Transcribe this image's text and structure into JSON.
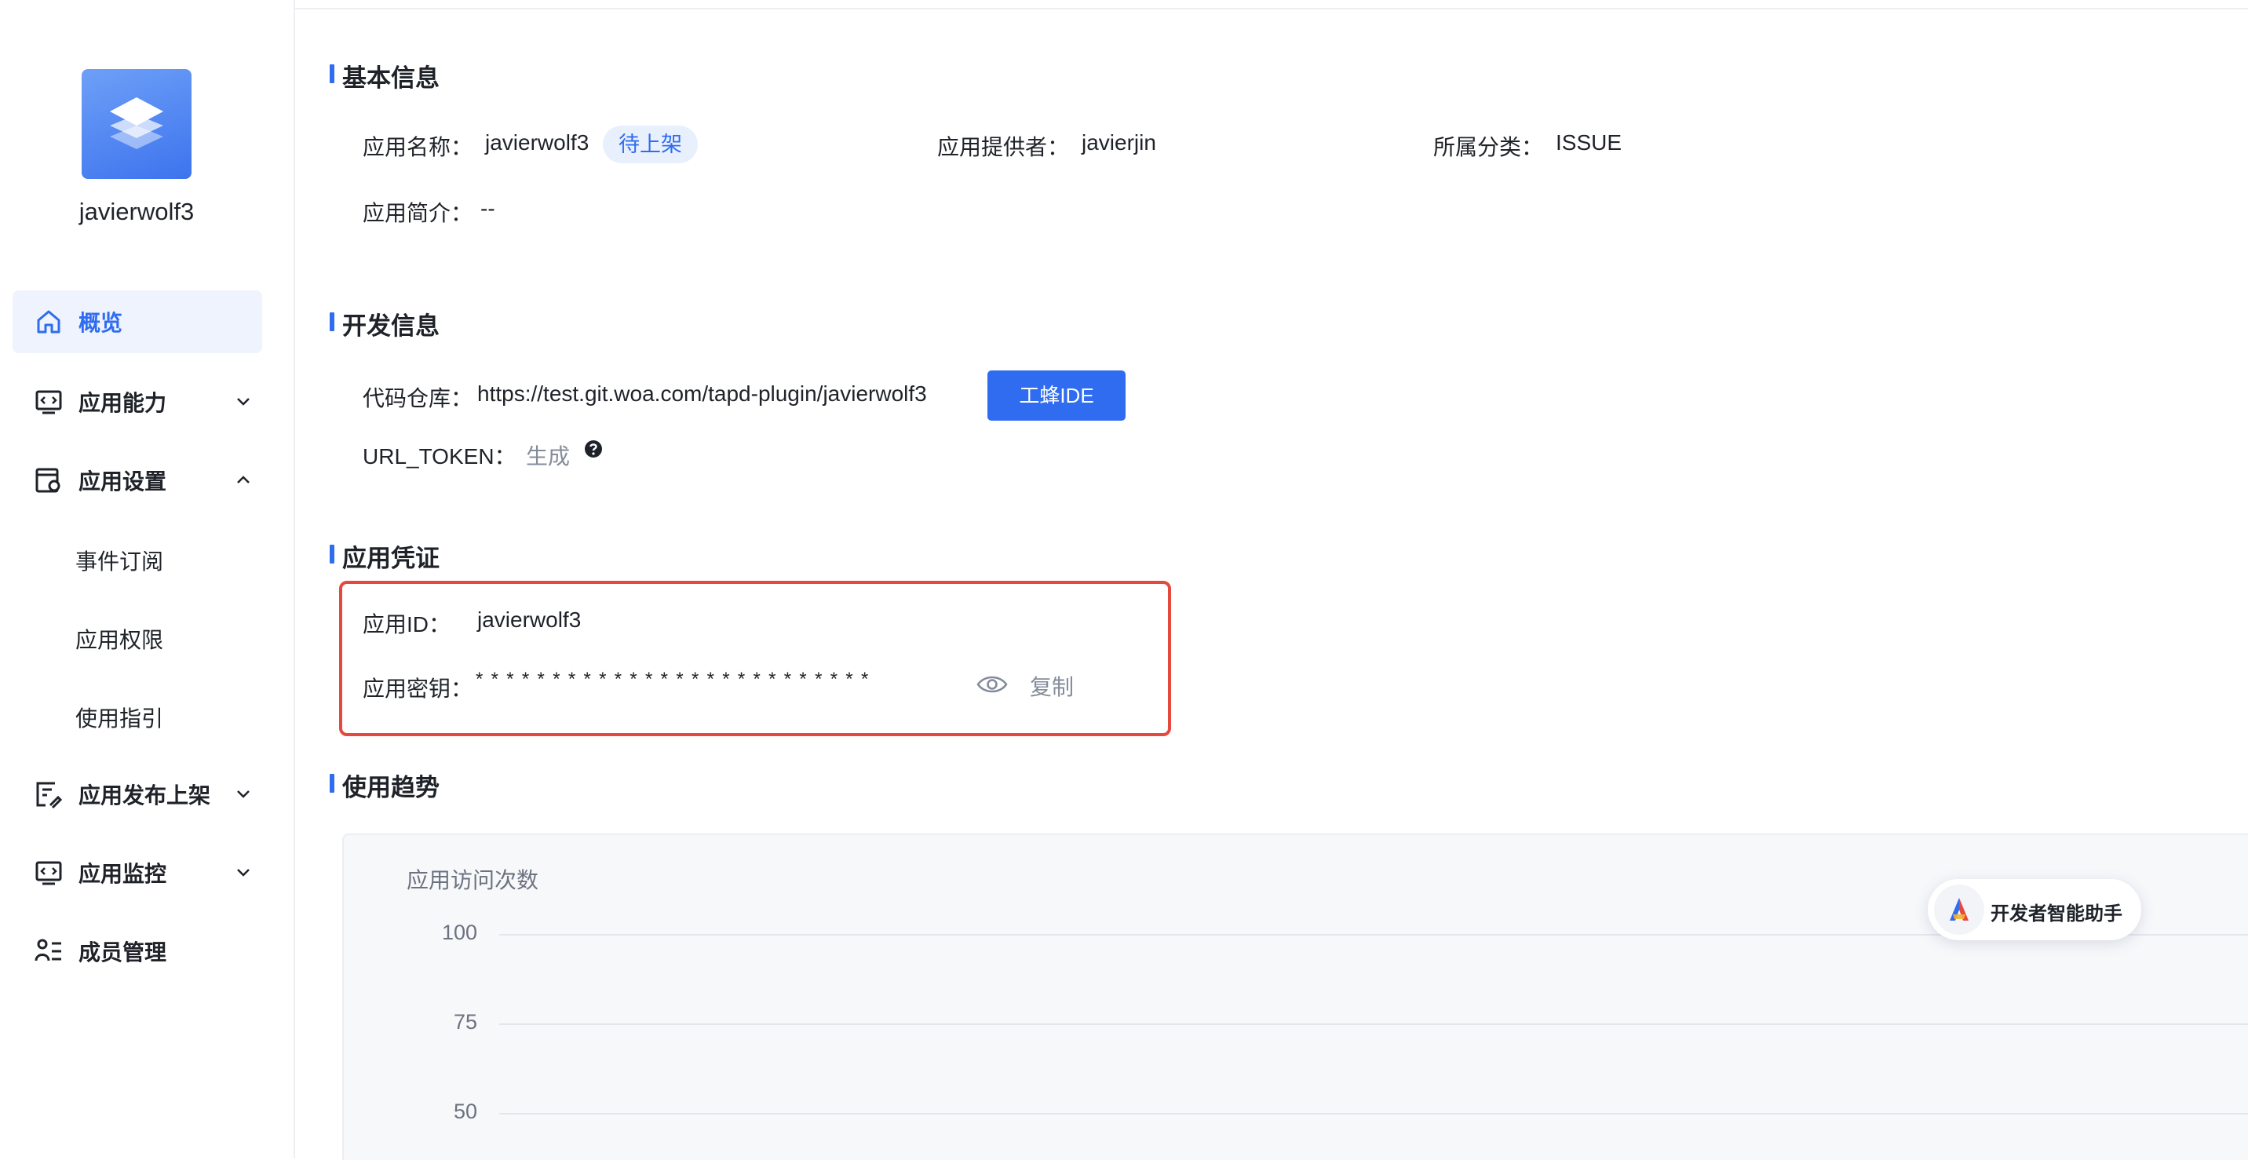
{
  "app": {
    "name": "javierwolf3"
  },
  "sidebar": {
    "items": [
      {
        "label": "概览",
        "icon": "home-icon",
        "active": true
      },
      {
        "label": "应用能力",
        "icon": "code-monitor-icon",
        "expanded": false
      },
      {
        "label": "应用设置",
        "icon": "settings-window-icon",
        "expanded": true
      },
      {
        "label": "应用发布上架",
        "icon": "publish-icon",
        "expanded": false
      },
      {
        "label": "应用监控",
        "icon": "monitor-icon",
        "expanded": false
      },
      {
        "label": "成员管理",
        "icon": "members-icon"
      }
    ],
    "sub_items": [
      "事件订阅",
      "应用权限",
      "使用指引"
    ]
  },
  "basic_info": {
    "title": "基本信息",
    "name_label": "应用名称：",
    "name_value": "javierwolf3",
    "status_tag": "待上架",
    "provider_label": "应用提供者：",
    "provider_value": "javierjin",
    "category_label": "所属分类：",
    "category_value": "ISSUE",
    "intro_label": "应用简介：",
    "intro_value": "--"
  },
  "dev_info": {
    "title": "开发信息",
    "repo_label": "代码仓库：",
    "repo_value": "https://test.git.woa.com/tapd-plugin/javierwolf3",
    "ide_button": "工蜂IDE",
    "token_label": "URL_TOKEN：",
    "token_action": "生成"
  },
  "credentials": {
    "title": "应用凭证",
    "id_label": "应用ID：",
    "id_value": "javierwolf3",
    "secret_label": "应用密钥：",
    "secret_masked": "**************************",
    "copy_label": "复制"
  },
  "usage": {
    "title": "使用趋势",
    "chart_title": "应用访问次数"
  },
  "chart_data": {
    "type": "line",
    "title": "应用访问次数",
    "yticks": [
      100,
      75,
      50
    ],
    "series": []
  },
  "assistant": {
    "label": "开发者智能助手"
  },
  "colors": {
    "primary": "#2f6cf0",
    "highlight_border": "#e5483c",
    "tag_bg": "#e9f0fd"
  }
}
